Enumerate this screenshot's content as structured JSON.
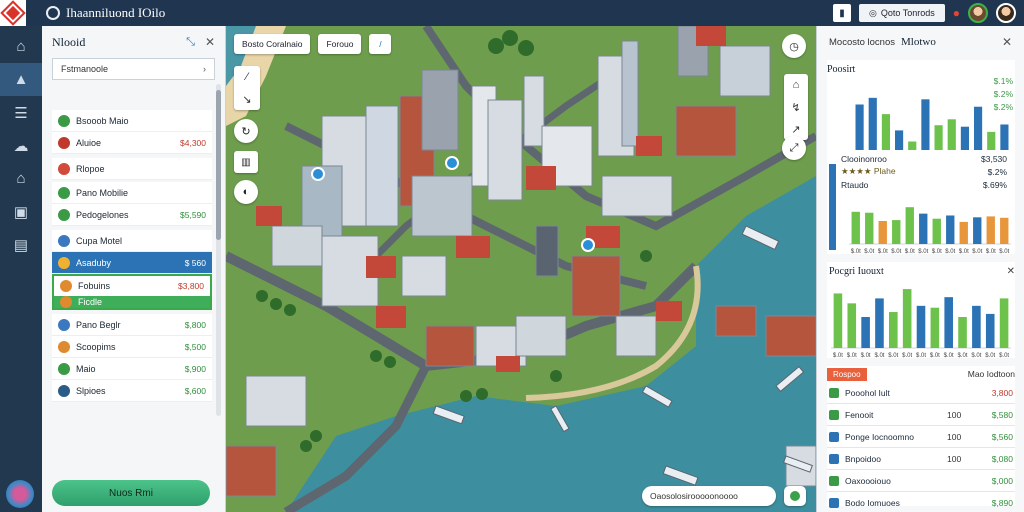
{
  "app": {
    "title": "Ihaanniluond IOilo"
  },
  "topbar": {
    "action_label": "Qoto Tonrods",
    "action_icon": "target-icon",
    "notification_icon": "bell-icon"
  },
  "rail": {
    "items": [
      "home-icon",
      "city-icon",
      "list-icon",
      "cloud-icon",
      "factory-icon",
      "storage-icon",
      "report-icon"
    ],
    "active_index": 1
  },
  "left_panel": {
    "title": "Nlooid",
    "selector_label": "Fstmanoole",
    "items": [
      {
        "label": "Bsooob Maio",
        "value": "",
        "color": "#3a9a45"
      },
      {
        "label": "Aluioe",
        "value": "$4,300",
        "color": "#c0392b"
      },
      {
        "label": "Rlopoe",
        "value": "",
        "color": "#d24a3a"
      },
      {
        "label": "Pano Mobilie",
        "value": "",
        "color": "#3a9a45"
      },
      {
        "label": "Pedogelones",
        "value": "$5,590",
        "color": "#3a9a45"
      },
      {
        "label": "Cupa Motel",
        "value": "",
        "color": "#3a78c0"
      },
      {
        "label": "Asaduby",
        "value": "$ 560",
        "color": "#f0b030"
      },
      {
        "label": "Fobuins",
        "value": "$3,800",
        "color": "#e08a30"
      },
      {
        "label": "Ficdle",
        "value": "",
        "color": "#e08a30"
      },
      {
        "label": "Pano Beglr",
        "value": "$,800",
        "color": "#3a78c0"
      },
      {
        "label": "Scoopims",
        "value": "$,500",
        "color": "#e08a30"
      },
      {
        "label": "Maio",
        "value": "$,900",
        "color": "#3a9a45"
      },
      {
        "label": "Slpioes",
        "value": "$,600",
        "color": "#2b5b87"
      }
    ],
    "action_label": "Nuos Rmi"
  },
  "map": {
    "toolbar": [
      "Bosto Coralnaio",
      "Forouo"
    ],
    "search_text": "Oaosolosirooooonoooo"
  },
  "right_panel": {
    "header_prefix": "Mocosto locnos",
    "header_title": "Mlotwo",
    "card1": {
      "title": "Poosirt",
      "stats": [
        {
          "k": "",
          "v": "$.1%"
        },
        {
          "k": "",
          "v": "$.2%"
        },
        {
          "k": "",
          "v": "$.2%"
        }
      ]
    },
    "card1b": {
      "stats": [
        {
          "k": "Clooinonroo",
          "v": "$3,530"
        },
        {
          "k": "★★★★ Plahe",
          "v": "$.2%"
        },
        {
          "k": "Rtaudo",
          "v": "$.69%"
        }
      ]
    },
    "card2": {
      "title": "Pocgri Iuouxt"
    },
    "list": {
      "badge": "Rospoo",
      "right": "Mao Iodtoon",
      "rows": [
        {
          "label": "Pooohol Iult",
          "mid": "",
          "value": "3,800",
          "color": "#3a9a45"
        },
        {
          "label": "Fenooit",
          "mid": "100",
          "value": "$,580",
          "color": "#3a9a45"
        },
        {
          "label": "Ponge Iocnoomno",
          "mid": "100",
          "value": "$,560",
          "color": "#2b73b5"
        },
        {
          "label": "Bnpoidoo",
          "mid": "100",
          "value": "$,080",
          "color": "#2b73b5"
        },
        {
          "label": "Oaxoooiouo",
          "mid": "",
          "value": "$,000",
          "color": "#3a9a45"
        },
        {
          "label": "Bodo Iomuoes",
          "mid": "",
          "value": "$,890",
          "color": "#2b73b5"
        }
      ]
    }
  },
  "chart_data": [
    {
      "type": "bar",
      "title": "Poosirt",
      "categories": [
        "1",
        "2",
        "3",
        "4",
        "5",
        "6",
        "7",
        "8",
        "9",
        "10",
        "11",
        "12"
      ],
      "values": [
        75,
        84,
        62,
        40,
        25,
        82,
        47,
        55,
        45,
        72,
        38,
        48
      ],
      "colors": [
        "#2b73b5",
        "#2b73b5",
        "#6cc24a",
        "#2b73b5",
        "#6cc24a",
        "#2b73b5",
        "#6cc24a",
        "#6cc24a",
        "#2b73b5",
        "#2b73b5",
        "#6cc24a",
        "#2b73b5"
      ],
      "ylim": [
        0,
        100
      ]
    },
    {
      "type": "bar",
      "categories": [
        "1",
        "2",
        "3",
        "4",
        "5",
        "6",
        "7",
        "8",
        "9",
        "10",
        "11",
        "12"
      ],
      "values": [
        70,
        68,
        50,
        52,
        80,
        66,
        55,
        62,
        48,
        58,
        60,
        57
      ],
      "colors": [
        "#6cc24a",
        "#6cc24a",
        "#e8963c",
        "#6cc24a",
        "#6cc24a",
        "#2b73b5",
        "#6cc24a",
        "#2b73b5",
        "#e8963c",
        "#2b73b5",
        "#e8963c",
        "#e8963c"
      ],
      "tick_labels": [
        "$.0t",
        "$.0t",
        "$.0t",
        "$.0t",
        "$.0t",
        "$.0t",
        "$.0t",
        "$.0t",
        "$.0t",
        "$.0t",
        "$.0t",
        "$.0t"
      ],
      "ylim": [
        0,
        100
      ]
    },
    {
      "type": "bar",
      "title": "Pocgri Iuouxt",
      "categories": [
        "1",
        "2",
        "3",
        "4",
        "5",
        "6",
        "7",
        "8",
        "9",
        "10",
        "11",
        "12",
        "13"
      ],
      "values": [
        88,
        72,
        50,
        80,
        58,
        95,
        68,
        65,
        82,
        50,
        68,
        55,
        80
      ],
      "colors": [
        "#6cc24a",
        "#6cc24a",
        "#2b73b5",
        "#2b73b5",
        "#6cc24a",
        "#6cc24a",
        "#2b73b5",
        "#6cc24a",
        "#2b73b5",
        "#6cc24a",
        "#2b73b5",
        "#2b73b5",
        "#6cc24a"
      ],
      "tick_labels": [
        "$.0t",
        "$.0t",
        "$.0t",
        "$.0t",
        "$.0t",
        "$.0t",
        "$.0t",
        "$.0t",
        "$.0t",
        "$.0t",
        "$.0t",
        "$.0t",
        "$.0t"
      ],
      "ylim": [
        0,
        100
      ]
    }
  ]
}
